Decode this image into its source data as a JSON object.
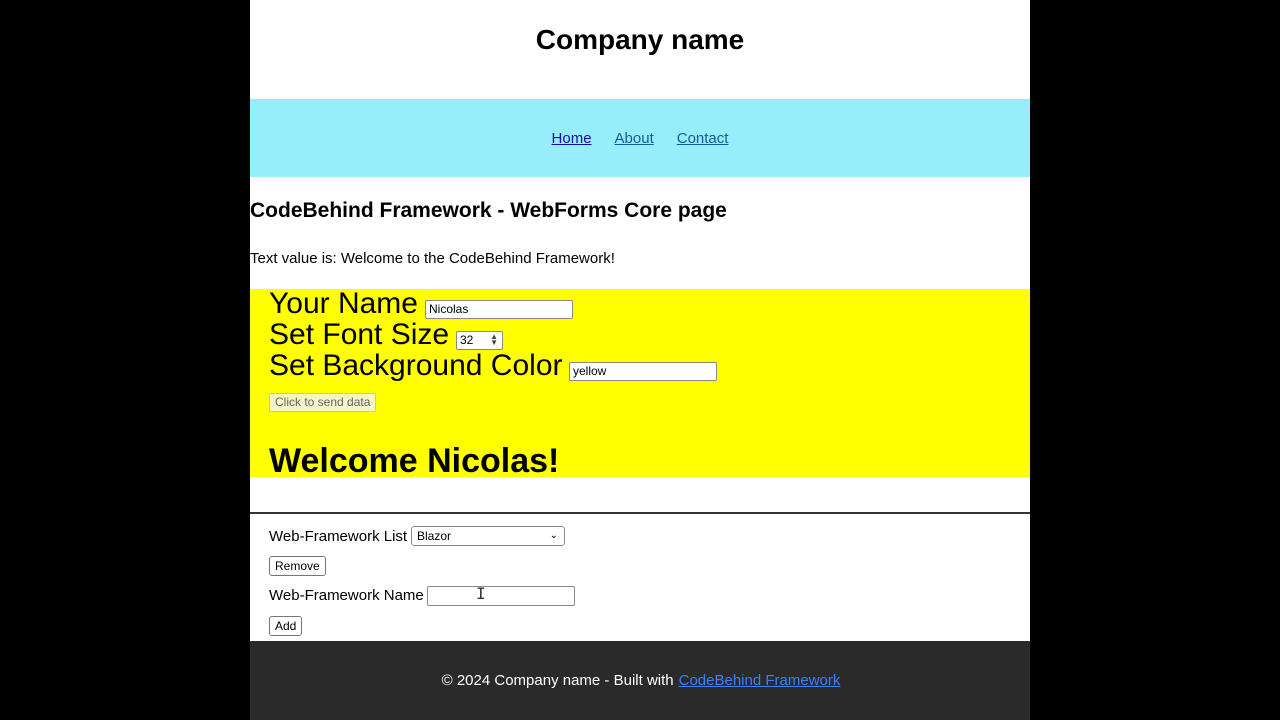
{
  "header": {
    "title": "Company name"
  },
  "nav": {
    "items": [
      "Home",
      "About",
      "Contact"
    ]
  },
  "main": {
    "title": "CodeBehind Framework - WebForms Core page",
    "text_value": "Text value is: Welcome to the CodeBehind Framework!"
  },
  "form": {
    "name_label": "Your Name",
    "name_value": "Nicolas",
    "font_size_label": "Set Font Size",
    "font_size_value": "32",
    "bg_color_label": "Set Background Color",
    "bg_color_value": "yellow",
    "send_button": "Click to send data",
    "welcome": "Welcome Nicolas!",
    "panel_color": "#ffff00"
  },
  "frameworks": {
    "list_label": "Web-Framework List",
    "selected": "Blazor",
    "remove_button": "Remove",
    "name_label": "Web-Framework Name",
    "name_value": "",
    "add_button": "Add"
  },
  "footer": {
    "text": "© 2024 Company name - Built with",
    "link": "CodeBehind Framework"
  }
}
